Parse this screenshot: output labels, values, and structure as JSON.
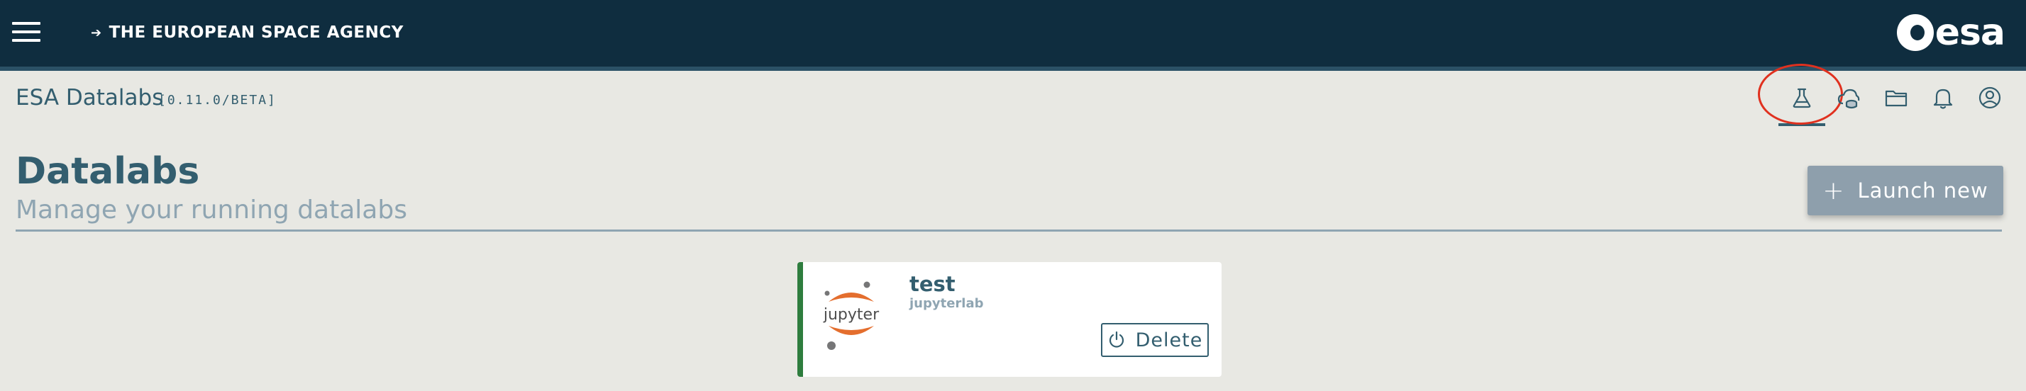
{
  "header": {
    "menu_icon": "hamburger-menu-icon",
    "agency_link": "THE EUROPEAN SPACE AGENCY",
    "agency_arrow": "➔",
    "logo_text": "esa"
  },
  "appbar": {
    "title": "ESA Datalabs",
    "version": "[0.11.0/BETA]",
    "icons": [
      "datalabs-flask-icon",
      "cloud-storage-icon",
      "folder-icon",
      "bell-icon",
      "user-account-icon"
    ],
    "active_icon": "datalabs-flask-icon",
    "highlight_color": "#e0311f"
  },
  "page": {
    "title": "Datalabs",
    "subtitle": "Manage your running datalabs",
    "launch_button": {
      "icon": "+",
      "label": "Launch new"
    }
  },
  "datalabs": [
    {
      "name": "test",
      "type": "jupyterlab",
      "logo_text": "jupyter",
      "status_color": "#2e7d3e",
      "delete_label": "Delete"
    }
  ],
  "colors": {
    "topbar": "#0f2d3f",
    "background": "#e8e8e3",
    "primary_text": "#335e6f",
    "muted_text": "#8fa5b2",
    "launch_button": "#8e9fac",
    "jupyter_orange": "#e46e2e"
  }
}
